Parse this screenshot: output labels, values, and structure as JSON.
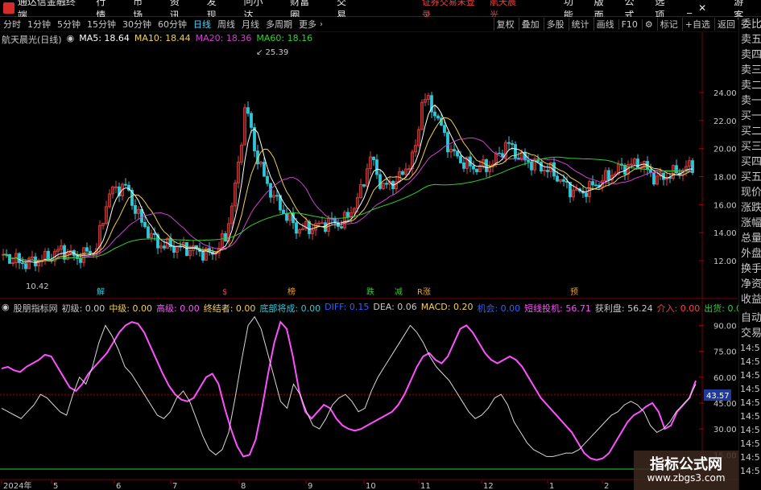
{
  "app": {
    "title": "通达信金融终端",
    "warning": "证券交易未登录",
    "stock_name": "航天晨光",
    "guest": "游客"
  },
  "menu": [
    "行情",
    "市场",
    "资讯",
    "发现",
    "问小达",
    "财富圈",
    "交易"
  ],
  "right_menu": [
    "功能",
    "版面",
    "公式",
    "选项"
  ],
  "periods": [
    "分时",
    "1分钟",
    "5分钟",
    "15分钟",
    "30分钟",
    "60分钟",
    "日线",
    "周线",
    "月线",
    "多周期",
    "更多"
  ],
  "active_period": "日线",
  "tools": [
    "复权",
    "叠加",
    "多股",
    "统计",
    "画线",
    "F10",
    "标记",
    "+自选",
    "返回"
  ],
  "main_info": {
    "name": "航天晨光(日线)",
    "ma5": "MA5: 18.64",
    "ma10": "MA10: 18.44",
    "ma20": "MA20: 18.36",
    "ma60": "MA60: 18.16"
  },
  "colors": {
    "ma5": "#ffffff",
    "ma10": "#f0d050",
    "ma20": "#d040d0",
    "ma60": "#30d030",
    "up": "#e84040",
    "down": "#30c8d8",
    "pink": "#ff50ff"
  },
  "price_axis": [
    "24.00",
    "22.00",
    "20.00",
    "18.00",
    "16.00",
    "14.00",
    "12.00"
  ],
  "annotations": {
    "high": "25.39",
    "low": "10.42"
  },
  "event_tags": [
    {
      "label": "解",
      "color": "#30c8d8"
    },
    {
      "label": "$",
      "color": "#ff4040"
    },
    {
      "label": "榜",
      "color": "#f0a020"
    },
    {
      "label": "跌",
      "color": "#30d030"
    },
    {
      "label": "减",
      "color": "#30d030"
    },
    {
      "label": "R涨",
      "color": "#f0a020"
    },
    {
      "label": "预",
      "color": "#f0a020"
    }
  ],
  "lower_info": [
    {
      "text": "股朋指标网",
      "color": "#c8c8c8"
    },
    {
      "text": "初级: 0.00",
      "color": "#c8c8c8"
    },
    {
      "text": "中级: 0.00",
      "color": "#f0d050"
    },
    {
      "text": "高级: 0.00",
      "color": "#ff50ff"
    },
    {
      "text": "终结者: 0.00",
      "color": "#f0d050"
    },
    {
      "text": "底部将成: 0.00",
      "color": "#30c8d8"
    },
    {
      "text": "DIFF: 0.15",
      "color": "#3060ff"
    },
    {
      "text": "DEA: 0.06",
      "color": "#c8c8c8"
    },
    {
      "text": "MACD: 0.20",
      "color": "#f0d050"
    },
    {
      "text": "机会: 0.00",
      "color": "#3060ff"
    },
    {
      "text": "短线投机: 56.71",
      "color": "#ff50ff"
    },
    {
      "text": "获利盘: 56.24",
      "color": "#c8c8c8"
    },
    {
      "text": "介入: 0.00",
      "color": "#ff4040"
    },
    {
      "text": "出货: 0.00",
      "color": "#30d030"
    }
  ],
  "lower_axis": [
    "90.00",
    "75.00",
    "60.00",
    "45.00",
    "30.00",
    "15.00"
  ],
  "lower_current": "43.57",
  "date_axis": [
    "2024年",
    "5",
    "6",
    "7",
    "8",
    "9",
    "10",
    "11",
    "12",
    "1",
    "2"
  ],
  "side_labels": [
    "委比",
    "卖五",
    "卖四",
    "卖三",
    "卖二",
    "卖一",
    "买一",
    "买二",
    "买三",
    "买四",
    "买五",
    "现价",
    "涨跌",
    "涨幅",
    "总量",
    "外盘",
    "换手",
    "净资",
    "收益"
  ],
  "side_trade": [
    "自动",
    "交易"
  ],
  "side_times": [
    "14:5",
    "14:5",
    "14:5",
    "14:5",
    "14:5",
    "14:5",
    "14:5",
    "14:5",
    "14:5",
    "14:5"
  ],
  "watermark": {
    "line1": "指标公式网",
    "line2": "www.zbgs3.com"
  },
  "chart_data": {
    "type": "line",
    "series": [
      {
        "name": "短线投机",
        "values": [
          65,
          66,
          64,
          63,
          66,
          68,
          70,
          73,
          72,
          66,
          60,
          54,
          52,
          56,
          62,
          66,
          70,
          74,
          80,
          86,
          90,
          92,
          91,
          86,
          78,
          70,
          62,
          55,
          50,
          47,
          46,
          48,
          54,
          60,
          62,
          56,
          42,
          30,
          20,
          14,
          15,
          24,
          42,
          62,
          80,
          92,
          88,
          72,
          52,
          40,
          36,
          40,
          44,
          42,
          36,
          32,
          30,
          29,
          30,
          32,
          34,
          36,
          38,
          40,
          44,
          50,
          58,
          66,
          72,
          74,
          70,
          68,
          72,
          80,
          88,
          90,
          86,
          80,
          74,
          70,
          68,
          70,
          72,
          70,
          66,
          60,
          54,
          48,
          44,
          40,
          36,
          32,
          28,
          22,
          16,
          13,
          12,
          13,
          16,
          22,
          28,
          34,
          38,
          40,
          43,
          45,
          40,
          30,
          32,
          40,
          44,
          48,
          58
        ]
      },
      {
        "name": "获利盘",
        "values": [
          42,
          40,
          38,
          36,
          40,
          44,
          50,
          48,
          44,
          40,
          38,
          50,
          60,
          56,
          66,
          80,
          90,
          84,
          76,
          66,
          62,
          56,
          50,
          44,
          38,
          36,
          40,
          48,
          52,
          46,
          36,
          26,
          18,
          15,
          18,
          28,
          48,
          70,
          90,
          95,
          88,
          74,
          60,
          46,
          42,
          56,
          50,
          40,
          32,
          30,
          36,
          44,
          48,
          50,
          46,
          40,
          42,
          52,
          60,
          66,
          72,
          78,
          84,
          90,
          86,
          80,
          72,
          66,
          62,
          58,
          52,
          46,
          40,
          36,
          38,
          42,
          48,
          50,
          44,
          34,
          28,
          22,
          18,
          16,
          14,
          14,
          15,
          16,
          16,
          18,
          22,
          26,
          30,
          34,
          38,
          40,
          44,
          46,
          44,
          40,
          32,
          28,
          30,
          34,
          40,
          44,
          48,
          56
        ]
      }
    ],
    "ylim": [
      10,
      100
    ]
  }
}
